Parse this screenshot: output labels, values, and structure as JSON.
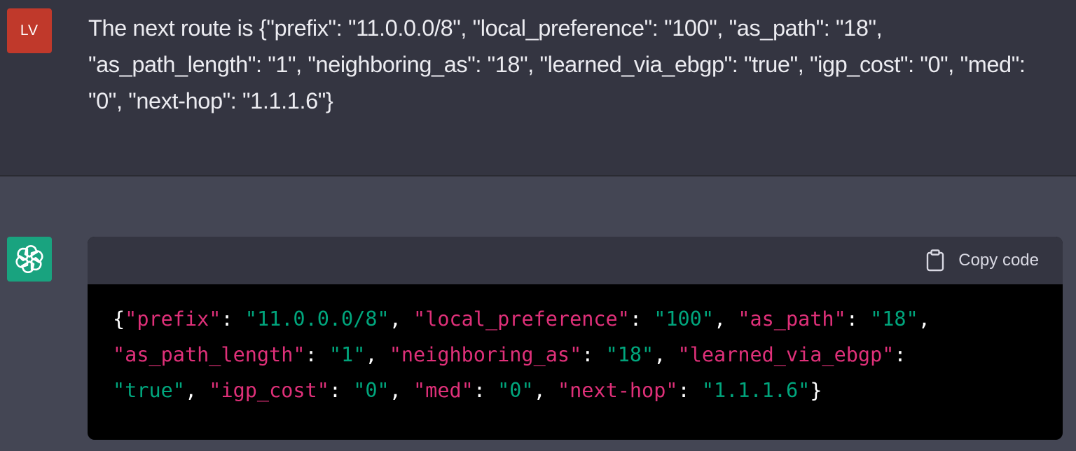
{
  "user_message": {
    "avatar_initials": "LV",
    "avatar_color": "#c0392b",
    "text": "The next route is {\"prefix\": \"11.0.0.0/8\", \"local_preference\": \"100\", \"as_path\": \"18\", \"as_path_length\": \"1\", \"neighboring_as\": \"18\", \"learned_via_ebgp\": \"true\", \"igp_cost\": \"0\", \"med\": \"0\", \"next-hop\": \"1.1.1.6\"}"
  },
  "assistant_message": {
    "avatar_icon": "openai-logo-icon",
    "avatar_color": "#19a37f",
    "code_block": {
      "copy_label": "Copy code",
      "copy_icon": "clipboard-icon",
      "key_color": "#df3079",
      "string_color": "#00a67d",
      "lines": [
        [
          {
            "t": "p",
            "v": "{"
          },
          {
            "t": "k",
            "v": "\"prefix\""
          },
          {
            "t": "p",
            "v": ": "
          },
          {
            "t": "s",
            "v": "\"11.0.0.0/8\""
          },
          {
            "t": "p",
            "v": ", "
          },
          {
            "t": "k",
            "v": "\"local_preference\""
          },
          {
            "t": "p",
            "v": ": "
          },
          {
            "t": "s",
            "v": "\"100\""
          },
          {
            "t": "p",
            "v": ", "
          },
          {
            "t": "k",
            "v": "\"as_path\""
          },
          {
            "t": "p",
            "v": ": "
          },
          {
            "t": "s",
            "v": "\"18\""
          },
          {
            "t": "p",
            "v": ","
          }
        ],
        [
          {
            "t": "k",
            "v": "\"as_path_length\""
          },
          {
            "t": "p",
            "v": ": "
          },
          {
            "t": "s",
            "v": "\"1\""
          },
          {
            "t": "p",
            "v": ", "
          },
          {
            "t": "k",
            "v": "\"neighboring_as\""
          },
          {
            "t": "p",
            "v": ": "
          },
          {
            "t": "s",
            "v": "\"18\""
          },
          {
            "t": "p",
            "v": ", "
          },
          {
            "t": "k",
            "v": "\"learned_via_ebgp\""
          },
          {
            "t": "p",
            "v": ":"
          }
        ],
        [
          {
            "t": "s",
            "v": "\"true\""
          },
          {
            "t": "p",
            "v": ", "
          },
          {
            "t": "k",
            "v": "\"igp_cost\""
          },
          {
            "t": "p",
            "v": ": "
          },
          {
            "t": "s",
            "v": "\"0\""
          },
          {
            "t": "p",
            "v": ", "
          },
          {
            "t": "k",
            "v": "\"med\""
          },
          {
            "t": "p",
            "v": ": "
          },
          {
            "t": "s",
            "v": "\"0\""
          },
          {
            "t": "p",
            "v": ", "
          },
          {
            "t": "k",
            "v": "\"next-hop\""
          },
          {
            "t": "p",
            "v": ": "
          },
          {
            "t": "s",
            "v": "\"1.1.1.6\""
          },
          {
            "t": "p",
            "v": "}"
          }
        ]
      ]
    }
  }
}
